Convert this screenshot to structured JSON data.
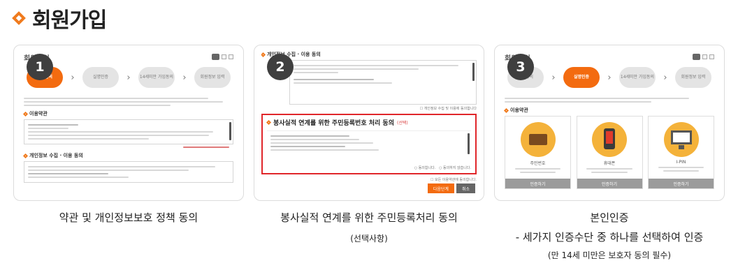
{
  "page": {
    "title": "회원가입"
  },
  "steps": [
    {
      "number": "1",
      "mini_title": "회원가입",
      "step_labels": [
        "약관동의",
        "실명인증",
        "14세미만 가입동의",
        "회원정보 입력"
      ],
      "section_terms": "이용약관",
      "section_privacy": "개인정보 수집 · 이용 동의",
      "caption_main": "약관 및 개인정보보호 정책 동의"
    },
    {
      "number": "2",
      "section_privacy": "개인정보 수집 · 이용 동의",
      "agree_line": "개인정보 수집 및 이용에 동의합니다",
      "red_title": "봉사실적 연계를 위한 주민등록번호 처리 동의",
      "red_optional": "(선택)",
      "red_agree": "동의합니다.",
      "red_disagree": "동의하지 않습니다.",
      "all_agree": "모든 이용약관에 동의합니다.",
      "next_button": "다음단계",
      "cancel_button": "취소",
      "caption_main": "봉사실적 연계를 위한 주민등록처리 동의",
      "caption_sub": "(선택사항)"
    },
    {
      "number": "3",
      "mini_title": "회원가입",
      "step_labels": [
        "약관동의",
        "실명인증",
        "14세미만 가입동의",
        "회원정보 입력"
      ],
      "section_terms": "이용약관",
      "methods": [
        {
          "name": "주민번호",
          "button": "인증하기",
          "icon": "id-card-icon"
        },
        {
          "name": "휴대폰",
          "button": "인증하기",
          "icon": "mobile-phone-icon"
        },
        {
          "name": "I-PIN",
          "button": "인증하기",
          "icon": "monitor-icon"
        }
      ],
      "caption_main": "본인인증",
      "caption_line2": "- 세가지 인증수단 중 하나를 선택하여 인증",
      "caption_sub": "(만 14세 미만은 보호자 동의 필수)"
    }
  ],
  "colors": {
    "accent": "#f36b10",
    "highlight_border": "#e0262a",
    "badge": "#3f3f3f"
  }
}
